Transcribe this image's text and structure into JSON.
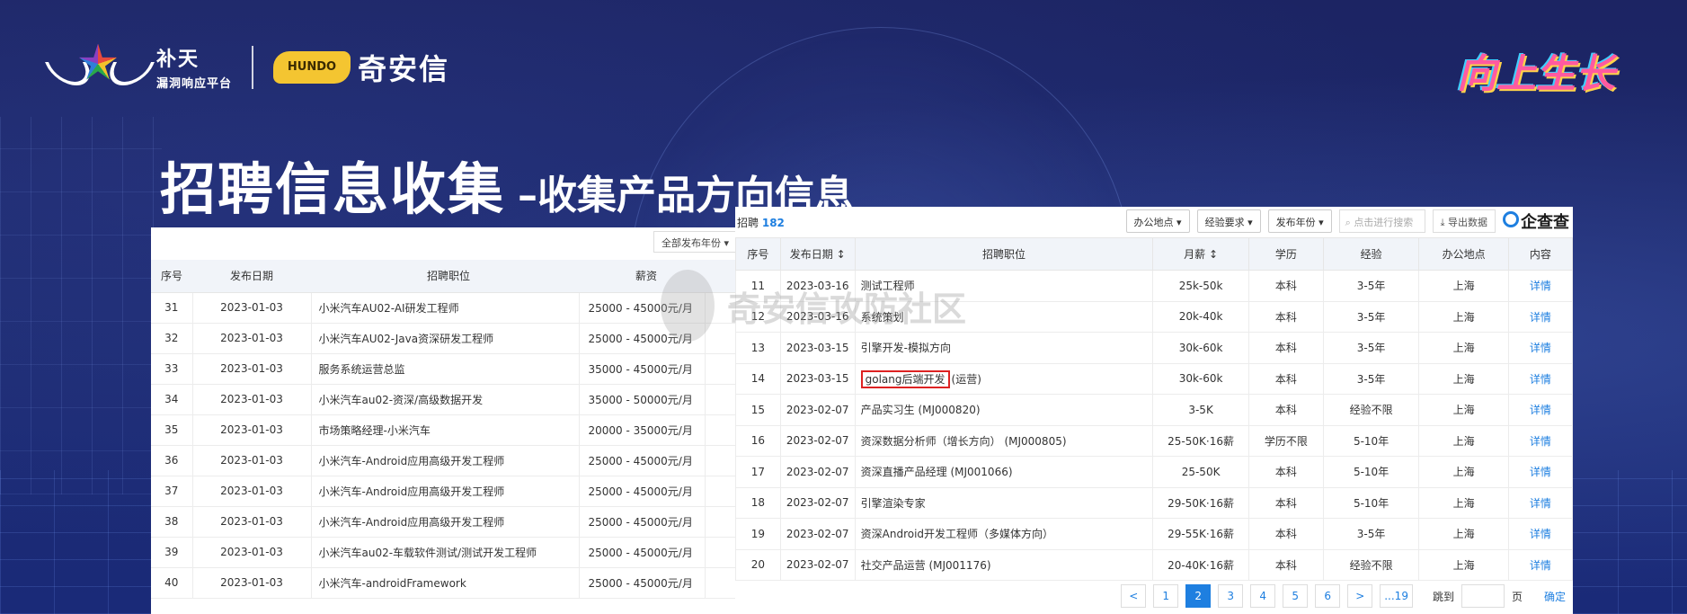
{
  "logo": {
    "butian_name": "补天",
    "butian_sub": "漏洞响应平台",
    "mascot_text": "HUNDO",
    "qianxin_name": "奇安信"
  },
  "badge": "向上生长",
  "title": {
    "main": "招聘信息收集",
    "sub": "–收集产品方向信息"
  },
  "left_table": {
    "filter_label": "全部发布年份 ▾",
    "headers": [
      "序号",
      "发布日期",
      "招聘职位",
      "薪资"
    ],
    "rows": [
      [
        "31",
        "2023-01-03",
        "小米汽车AU02-AI研发工程师",
        "25000 - 45000元/月"
      ],
      [
        "32",
        "2023-01-03",
        "小米汽车AU02-Java资深研发工程师",
        "25000 - 45000元/月"
      ],
      [
        "33",
        "2023-01-03",
        "服务系统运营总监",
        "35000 - 45000元/月"
      ],
      [
        "34",
        "2023-01-03",
        "小米汽车au02-资深/高级数据开发",
        "35000 - 50000元/月"
      ],
      [
        "35",
        "2023-01-03",
        "市场策略经理-小米汽车",
        "20000 - 35000元/月"
      ],
      [
        "36",
        "2023-01-03",
        "小米汽车-Android应用高级开发工程师",
        "25000 - 45000元/月"
      ],
      [
        "37",
        "2023-01-03",
        "小米汽车-Android应用高级开发工程师",
        "25000 - 45000元/月"
      ],
      [
        "38",
        "2023-01-03",
        "小米汽车-Android应用高级开发工程师",
        "25000 - 45000元/月"
      ],
      [
        "39",
        "2023-01-03",
        "小米汽车au02-车载软件测试/测试开发工程师",
        "25000 - 45000元/月"
      ],
      [
        "40",
        "2023-01-03",
        "小米汽车-androidFramework",
        "25000 - 45000元/月"
      ]
    ]
  },
  "right_table": {
    "header_label": "招聘",
    "count": "182",
    "filters": [
      "办公地点 ▾",
      "经验要求 ▾",
      "发布年份 ▾"
    ],
    "search_placeholder": "点击进行搜索",
    "export_label": "导出数据",
    "brand": "企查查",
    "headers": [
      "序号",
      "发布日期 ↕",
      "招聘职位",
      "月薪 ↕",
      "学历",
      "经验",
      "办公地点",
      "内容"
    ],
    "rows": [
      [
        "11",
        "2023-03-16",
        "测试工程师",
        "",
        "25k-50k",
        "本科",
        "3-5年",
        "上海",
        "详情"
      ],
      [
        "12",
        "2023-03-16",
        "系统策划",
        "",
        "20k-40k",
        "本科",
        "3-5年",
        "上海",
        "详情"
      ],
      [
        "13",
        "2023-03-15",
        "引擎开发-模拟方向",
        "",
        "30k-60k",
        "本科",
        "3-5年",
        "上海",
        "详情"
      ],
      [
        "14",
        "2023-03-15",
        "golang后端开发",
        "(运营)",
        "30k-60k",
        "本科",
        "3-5年",
        "上海",
        "详情"
      ],
      [
        "15",
        "2023-02-07",
        "产品实习生 (MJ000820)",
        "",
        "3-5K",
        "本科",
        "经验不限",
        "上海",
        "详情"
      ],
      [
        "16",
        "2023-02-07",
        "资深数据分析师（增长方向） (MJ000805)",
        "",
        "25-50K·16薪",
        "学历不限",
        "5-10年",
        "上海",
        "详情"
      ],
      [
        "17",
        "2023-02-07",
        "资深直播产品经理 (MJ001066)",
        "",
        "25-50K",
        "本科",
        "5-10年",
        "上海",
        "详情"
      ],
      [
        "18",
        "2023-02-07",
        "引擎渲染专家",
        "",
        "29-50K·16薪",
        "本科",
        "5-10年",
        "上海",
        "详情"
      ],
      [
        "19",
        "2023-02-07",
        "资深Android开发工程师（多媒体方向）",
        "",
        "29-55K·16薪",
        "本科",
        "3-5年",
        "上海",
        "详情"
      ],
      [
        "20",
        "2023-02-07",
        "社交产品运营 (MJ001176)",
        "",
        "20-40K·16薪",
        "本科",
        "经验不限",
        "上海",
        "详情"
      ]
    ],
    "pager": {
      "prev": "<",
      "pages": [
        "1",
        "2",
        "3",
        "4",
        "5",
        "6"
      ],
      "current": "2",
      "next": ">",
      "last": "...19",
      "jump_label": "跳到",
      "page_unit": "页",
      "confirm": "确定"
    }
  },
  "watermark": "奇安信攻防社区"
}
